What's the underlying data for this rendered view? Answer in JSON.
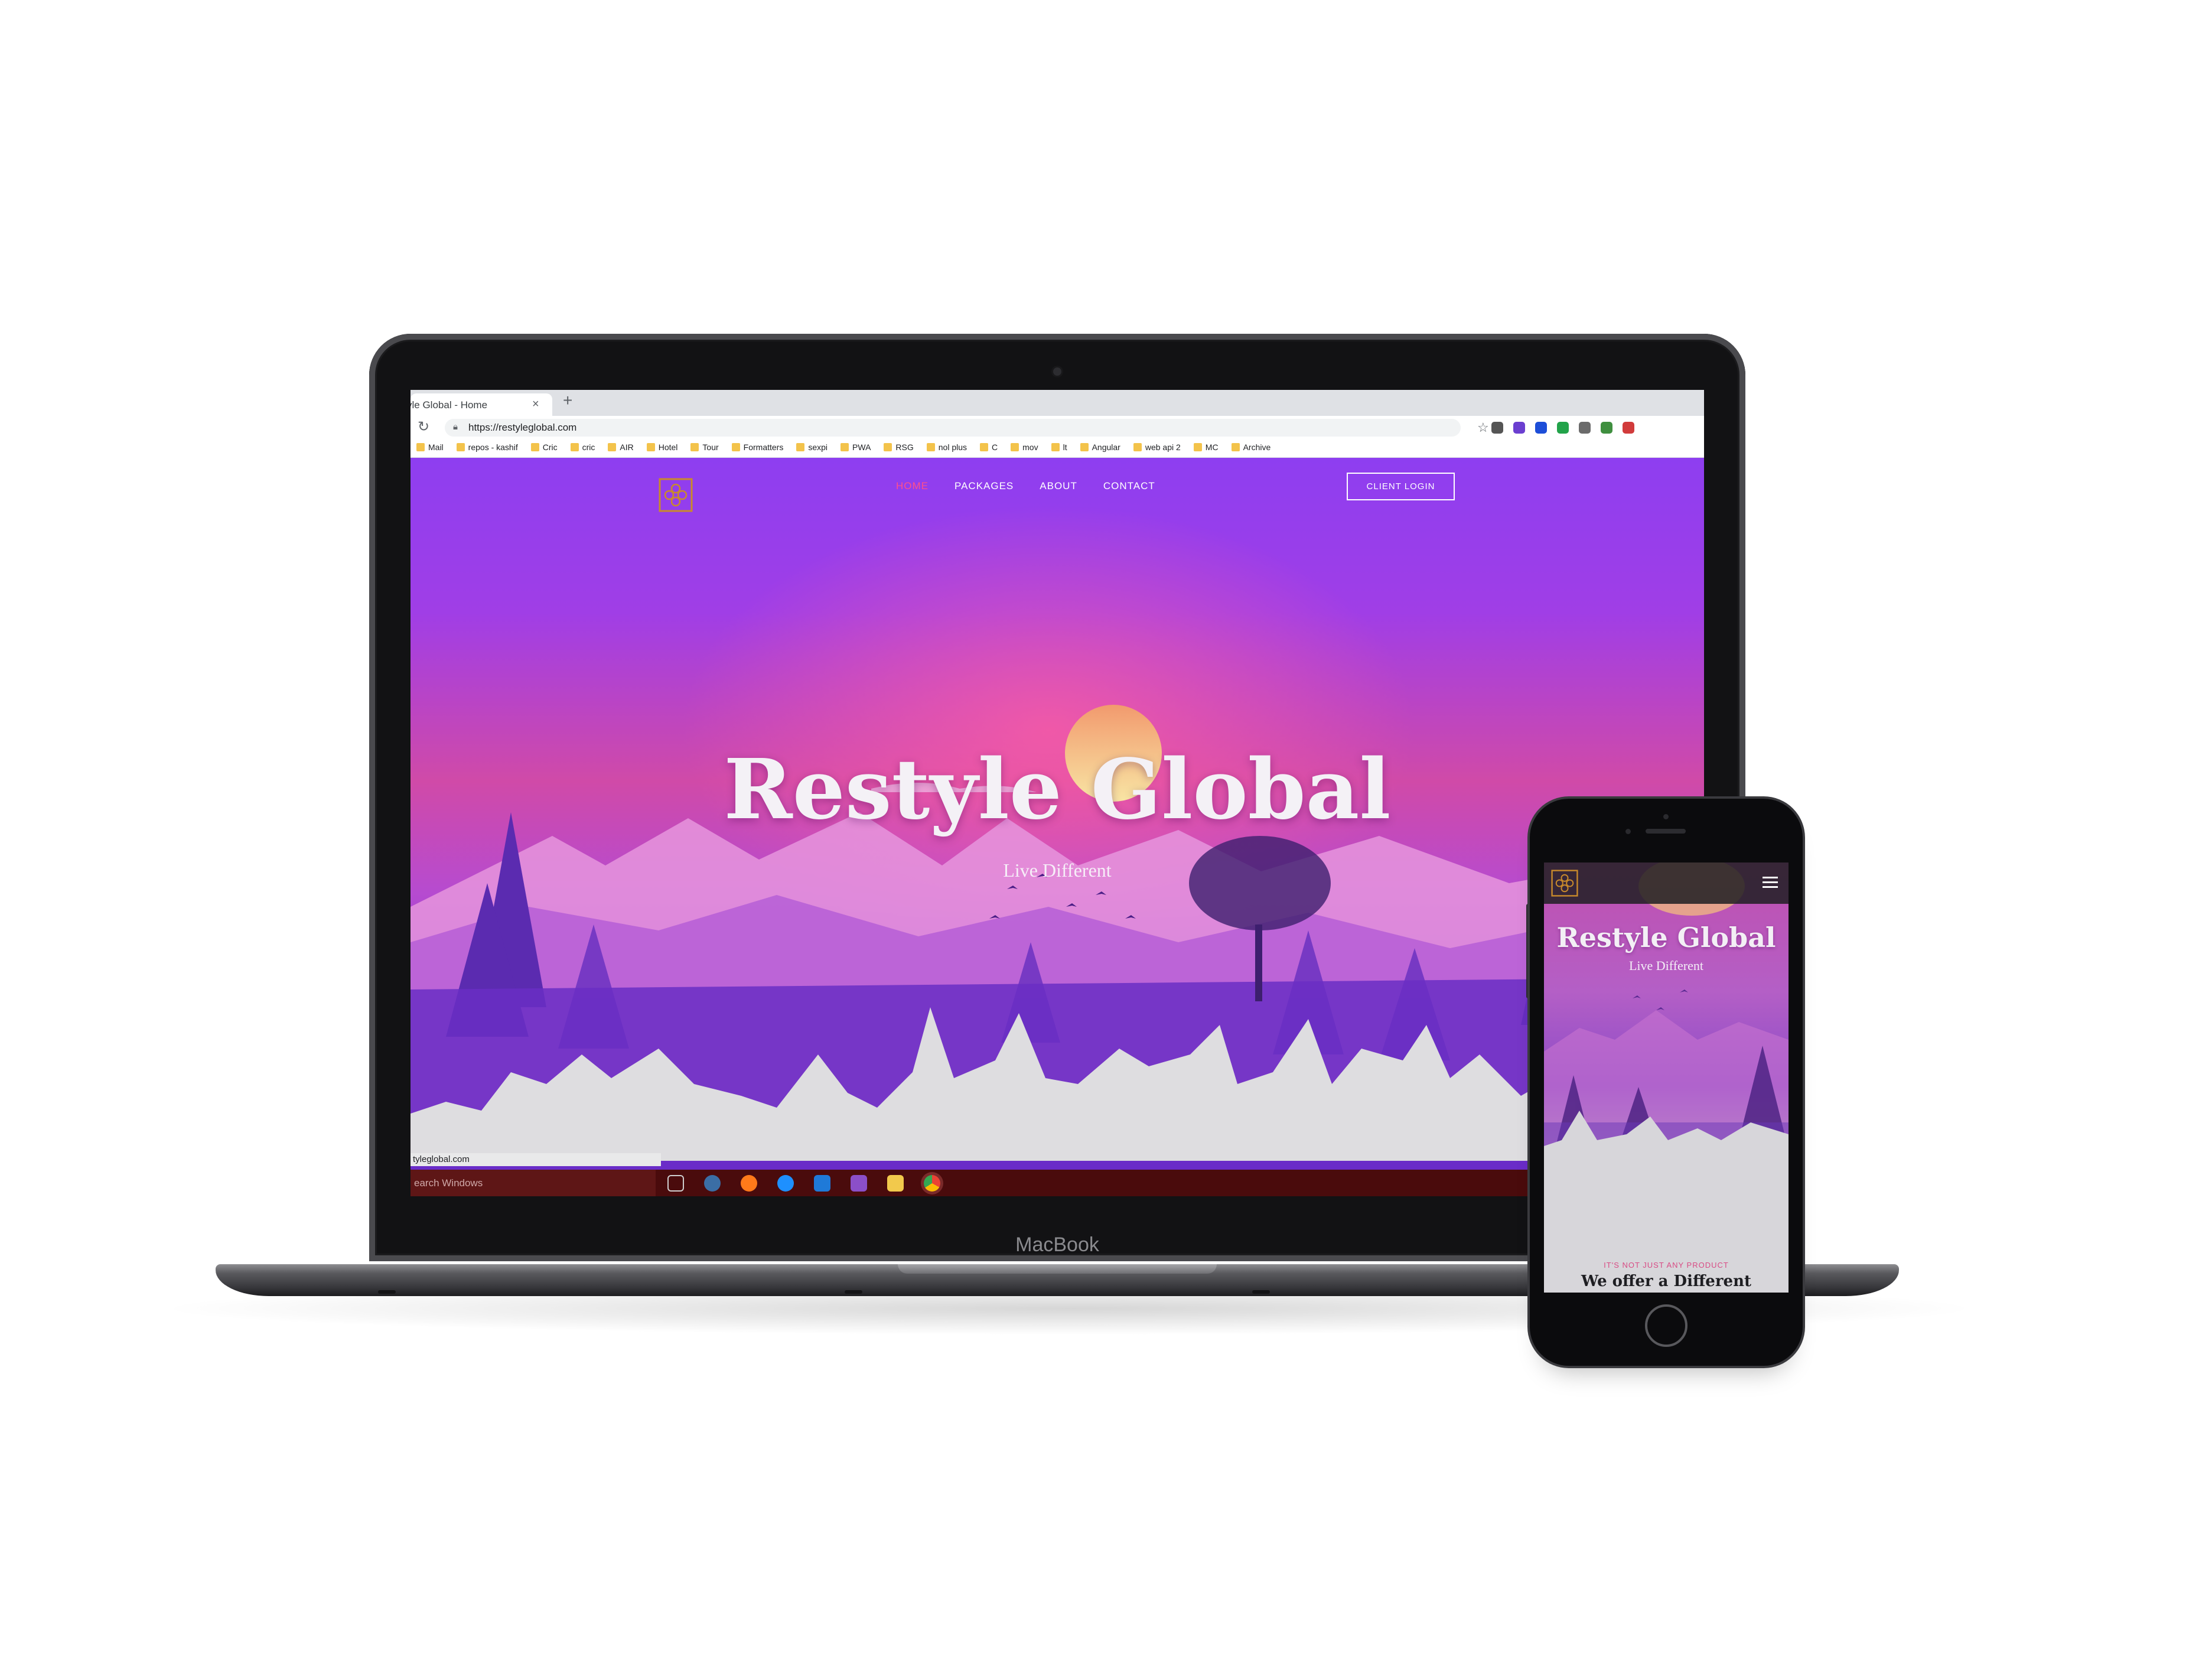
{
  "laptop": {
    "brand_label": "MacBook",
    "browser": {
      "tab_title": "yle Global - Home",
      "tab_close": "×",
      "new_tab": "+",
      "reload_icon": "reload-icon",
      "url": "https://restyleglobal.com",
      "bookmarks": [
        "Mail",
        "repos - kashif",
        "Cric",
        "cric",
        "AIR",
        "Hotel",
        "Tour",
        "Formatters",
        "sexpi",
        "PWA",
        "RSG",
        "nol plus",
        "C",
        "mov",
        "lt",
        "Angular",
        "web api 2",
        "MC",
        "Archive"
      ],
      "extensions": [
        "#555555",
        "#6b3fd0",
        "#1d4ed8",
        "#22a34a",
        "#6b6b6b",
        "#3f8f3f",
        "#d13b3b"
      ]
    },
    "site": {
      "nav": [
        "HOME",
        "PACKAGES",
        "ABOUT",
        "CONTACT"
      ],
      "active_nav": "HOME",
      "login_label": "CLIENT LOGIN",
      "hero_title": "Restyle Global",
      "hero_subtitle": "Live Different",
      "accent_color": "#ff4f8b",
      "logo_color": "#c98a2b"
    },
    "status_url": "tyleglobal.com",
    "taskbar": {
      "search_placeholder": "earch Windows",
      "apps": [
        "task-view-icon",
        "network-icon",
        "firefox-icon",
        "edge-icon",
        "vscode-icon",
        "visual-studio-icon",
        "file-explorer-icon",
        "chrome-icon"
      ]
    }
  },
  "phone": {
    "hero_title": "Restyle Global",
    "hero_subtitle": "Live Different",
    "overline": "IT'S NOT JUST ANY PRODUCT",
    "section_heading": "We offer a Different"
  }
}
